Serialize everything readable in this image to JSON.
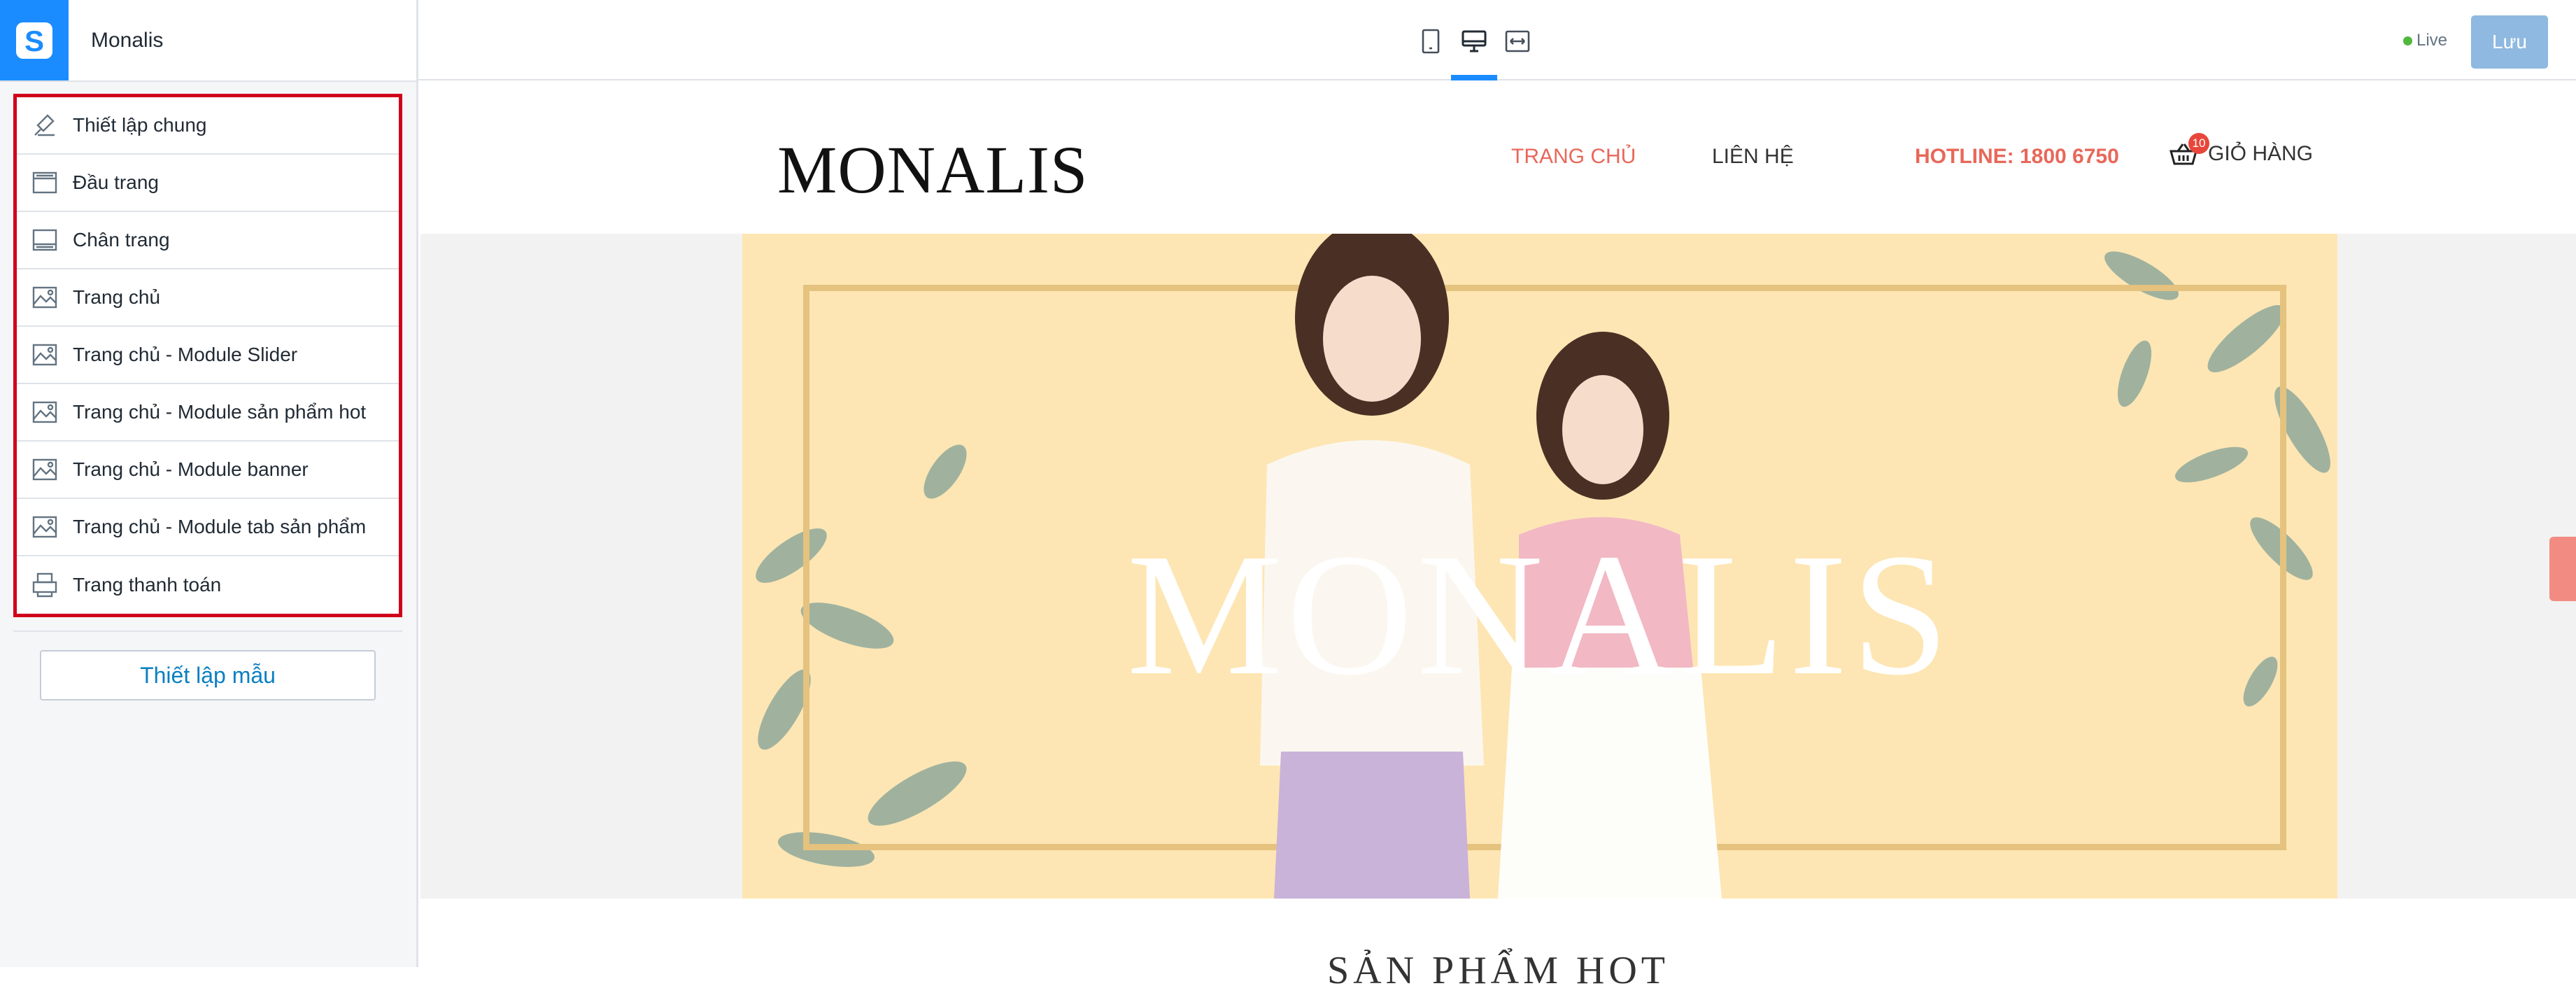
{
  "app": {
    "shop_name": "Monalis",
    "logo_letter": "S"
  },
  "sidebar": {
    "items": [
      {
        "label": "Thiết lập chung",
        "icon": "settings-brush-icon"
      },
      {
        "label": "Đầu trang",
        "icon": "header-layout-icon"
      },
      {
        "label": "Chân trang",
        "icon": "footer-layout-icon"
      },
      {
        "label": "Trang chủ",
        "icon": "image-page-icon"
      },
      {
        "label": "Trang chủ - Module Slider",
        "icon": "image-page-icon"
      },
      {
        "label": "Trang chủ - Module sản phẩm hot",
        "icon": "image-page-icon"
      },
      {
        "label": "Trang chủ - Module banner",
        "icon": "image-page-icon"
      },
      {
        "label": "Trang chủ - Module tab sản phẩm",
        "icon": "image-page-icon"
      },
      {
        "label": "Trang thanh toán",
        "icon": "checkout-printer-icon"
      }
    ],
    "template_button": "Thiết lập mẫu"
  },
  "toolbar": {
    "devices": [
      "mobile-icon",
      "desktop-icon",
      "fullwidth-icon"
    ],
    "active_device": "desktop",
    "live_label": "Live",
    "save_label": "Lưu"
  },
  "site": {
    "logo_text": "MONALIS",
    "nav": {
      "home": "TRANG CHỦ",
      "contact": "LIÊN HỆ",
      "hotline": "HOTLINE: 1800 6750",
      "cart_count": "10",
      "cart_label": "GIỎ HÀNG"
    },
    "banner_text": "MONALIS",
    "section_title": "SẢN PHẨM HOT"
  },
  "colors": {
    "accent": "#1a8cff",
    "highlight_border": "#d0021b",
    "nav_active": "#e8685a",
    "banner_bg": "#fde6b4",
    "save_button": "#8fb9e0"
  }
}
